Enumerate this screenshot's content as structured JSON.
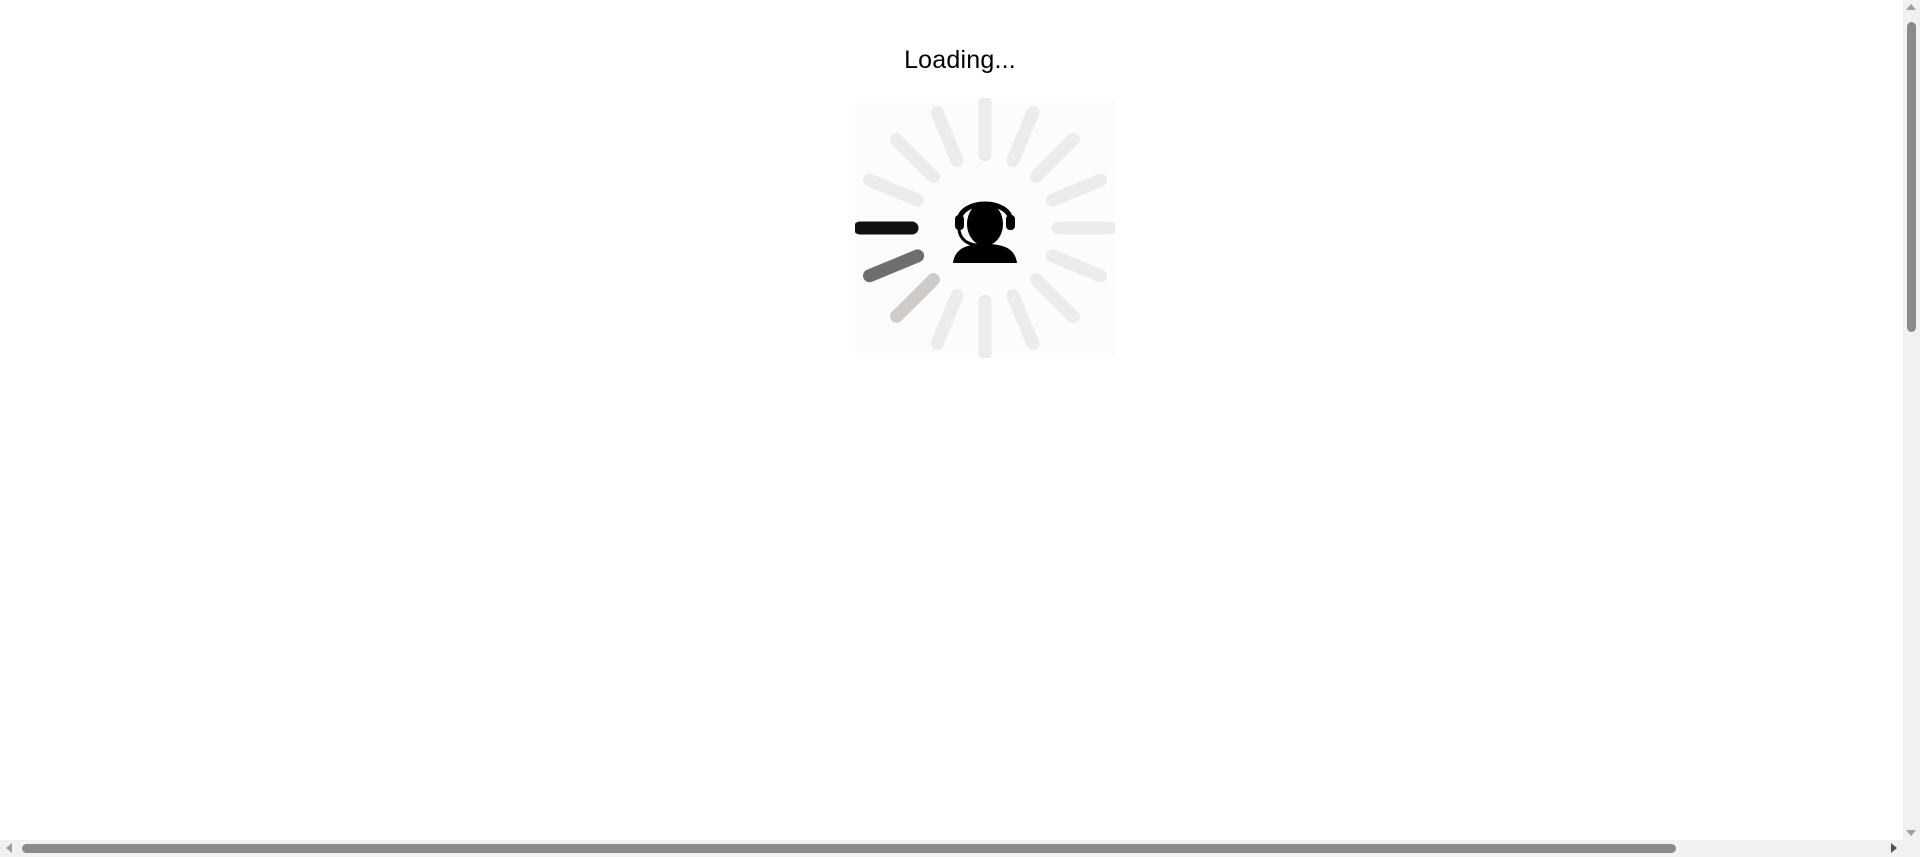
{
  "loading": {
    "text": "Loading..."
  },
  "spinner": {
    "center_icon": "support-agent-headset-icon",
    "spoke_count": 16,
    "active_color": "#111111",
    "trail_colors": [
      "#111111",
      "#6e6e6e",
      "#cfcbc9"
    ],
    "idle_color": "#ececec"
  },
  "colors": {
    "background": "#ffffff",
    "text": "#000000",
    "scrollbar_thumb": "#8a8a8a",
    "scrollbar_track": "#f1f1f1"
  }
}
